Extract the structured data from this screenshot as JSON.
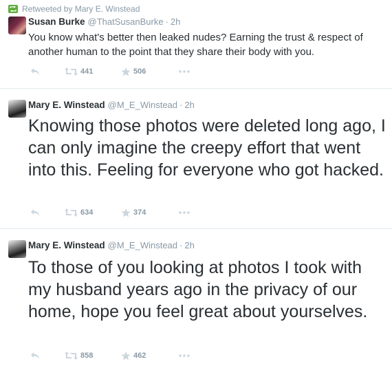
{
  "tweets": [
    {
      "context": "Retweeted by Mary E. Winstead",
      "fullname": "Susan Burke",
      "username": "@ThatSusanBurke",
      "separator": "·",
      "time": "2h",
      "text": "You know what's better then leaked nudes? Earning the trust & respect of another human to the point that they share their body with you.",
      "retweets": "441",
      "favorites": "506"
    },
    {
      "fullname": "Mary E. Winstead",
      "username": "@M_E_Winstead",
      "separator": "·",
      "time": "2h",
      "text": "Knowing those photos were deleted long ago, I can only imagine the creepy effort that went into this. Feeling for everyone who got hacked.",
      "retweets": "634",
      "favorites": "374"
    },
    {
      "fullname": "Mary E. Winstead",
      "username": "@M_E_Winstead",
      "separator": "·",
      "time": "2h",
      "text": "To those of you looking at photos I took with my husband years ago in the privacy of our home, hope you feel great about yourselves.",
      "retweets": "858",
      "favorites": "462"
    }
  ],
  "colors": {
    "text": "#292f33",
    "muted": "#8899a6",
    "icon": "#ccd6dd",
    "retweet_badge": "#5dae3b",
    "divider": "#e1e8ed"
  },
  "icons": [
    "retweet-badge-icon",
    "reply-icon",
    "retweet-icon",
    "star-icon",
    "more-icon"
  ]
}
